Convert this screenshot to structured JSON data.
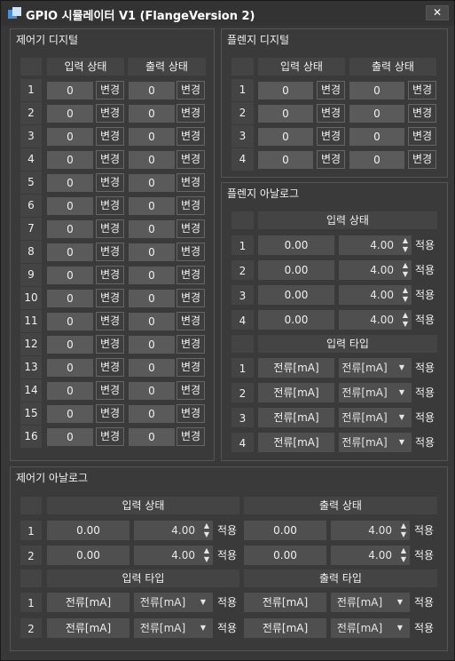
{
  "window": {
    "title": "GPIO 시뮬레이터 V1 (FlangeVersion 2)",
    "close_label": "✕"
  },
  "ctrl_digital": {
    "title": "제어기 디지털",
    "in_header": "입력 상태",
    "out_header": "출력 상태",
    "rows": [
      {
        "n": "1",
        "in": "0",
        "out": "0"
      },
      {
        "n": "2",
        "in": "0",
        "out": "0"
      },
      {
        "n": "3",
        "in": "0",
        "out": "0"
      },
      {
        "n": "4",
        "in": "0",
        "out": "0"
      },
      {
        "n": "5",
        "in": "0",
        "out": "0"
      },
      {
        "n": "6",
        "in": "0",
        "out": "0"
      },
      {
        "n": "7",
        "in": "0",
        "out": "0"
      },
      {
        "n": "8",
        "in": "0",
        "out": "0"
      },
      {
        "n": "9",
        "in": "0",
        "out": "0"
      },
      {
        "n": "10",
        "in": "0",
        "out": "0"
      },
      {
        "n": "11",
        "in": "0",
        "out": "0"
      },
      {
        "n": "12",
        "in": "0",
        "out": "0"
      },
      {
        "n": "13",
        "in": "0",
        "out": "0"
      },
      {
        "n": "14",
        "in": "0",
        "out": "0"
      },
      {
        "n": "15",
        "in": "0",
        "out": "0"
      },
      {
        "n": "16",
        "in": "0",
        "out": "0"
      }
    ]
  },
  "flange_digital": {
    "title": "플렌지 디지털",
    "in_header": "입력 상태",
    "out_header": "출력 상태",
    "rows": [
      {
        "n": "1",
        "in": "0",
        "out": "0"
      },
      {
        "n": "2",
        "in": "0",
        "out": "0"
      },
      {
        "n": "3",
        "in": "0",
        "out": "0"
      },
      {
        "n": "4",
        "in": "0",
        "out": "0"
      }
    ]
  },
  "flange_analog": {
    "title": "플렌지 아날로그",
    "state_header": "입력 상태",
    "type_header": "입력 타입",
    "state_rows": [
      {
        "n": "1",
        "value": "0.00",
        "set": "4.00"
      },
      {
        "n": "2",
        "value": "0.00",
        "set": "4.00"
      },
      {
        "n": "3",
        "value": "0.00",
        "set": "4.00"
      },
      {
        "n": "4",
        "value": "0.00",
        "set": "4.00"
      }
    ],
    "type_rows": [
      {
        "n": "1",
        "value": "전류[mA]",
        "set": "전류[mA]"
      },
      {
        "n": "2",
        "value": "전류[mA]",
        "set": "전류[mA]"
      },
      {
        "n": "3",
        "value": "전류[mA]",
        "set": "전류[mA]"
      },
      {
        "n": "4",
        "value": "전류[mA]",
        "set": "전류[mA]"
      }
    ]
  },
  "ctrl_analog": {
    "title": "제어기 아날로그",
    "in_state_header": "입력 상태",
    "out_state_header": "출력 상태",
    "in_type_header": "입력 타입",
    "out_type_header": "출력 타입",
    "state_rows": [
      {
        "n": "1",
        "in_value": "0.00",
        "in_set": "4.00",
        "out_value": "0.00",
        "out_set": "4.00"
      },
      {
        "n": "2",
        "in_value": "0.00",
        "in_set": "4.00",
        "out_value": "0.00",
        "out_set": "4.00"
      }
    ],
    "type_rows": [
      {
        "n": "1",
        "in_value": "전류[mA]",
        "in_set": "전류[mA]",
        "out_value": "전류[mA]",
        "out_set": "전류[mA]"
      },
      {
        "n": "2",
        "in_value": "전류[mA]",
        "in_set": "전류[mA]",
        "out_value": "전류[mA]",
        "out_set": "전류[mA]"
      }
    ]
  },
  "labels": {
    "change": "변경",
    "apply": "적용",
    "spin_up": "▲",
    "spin_down": "▼",
    "dropdown": "▼"
  },
  "colors": {
    "window_bg": "#383838",
    "field_bg": "#5a5a5a",
    "accent_icon": "#4a90d9"
  }
}
